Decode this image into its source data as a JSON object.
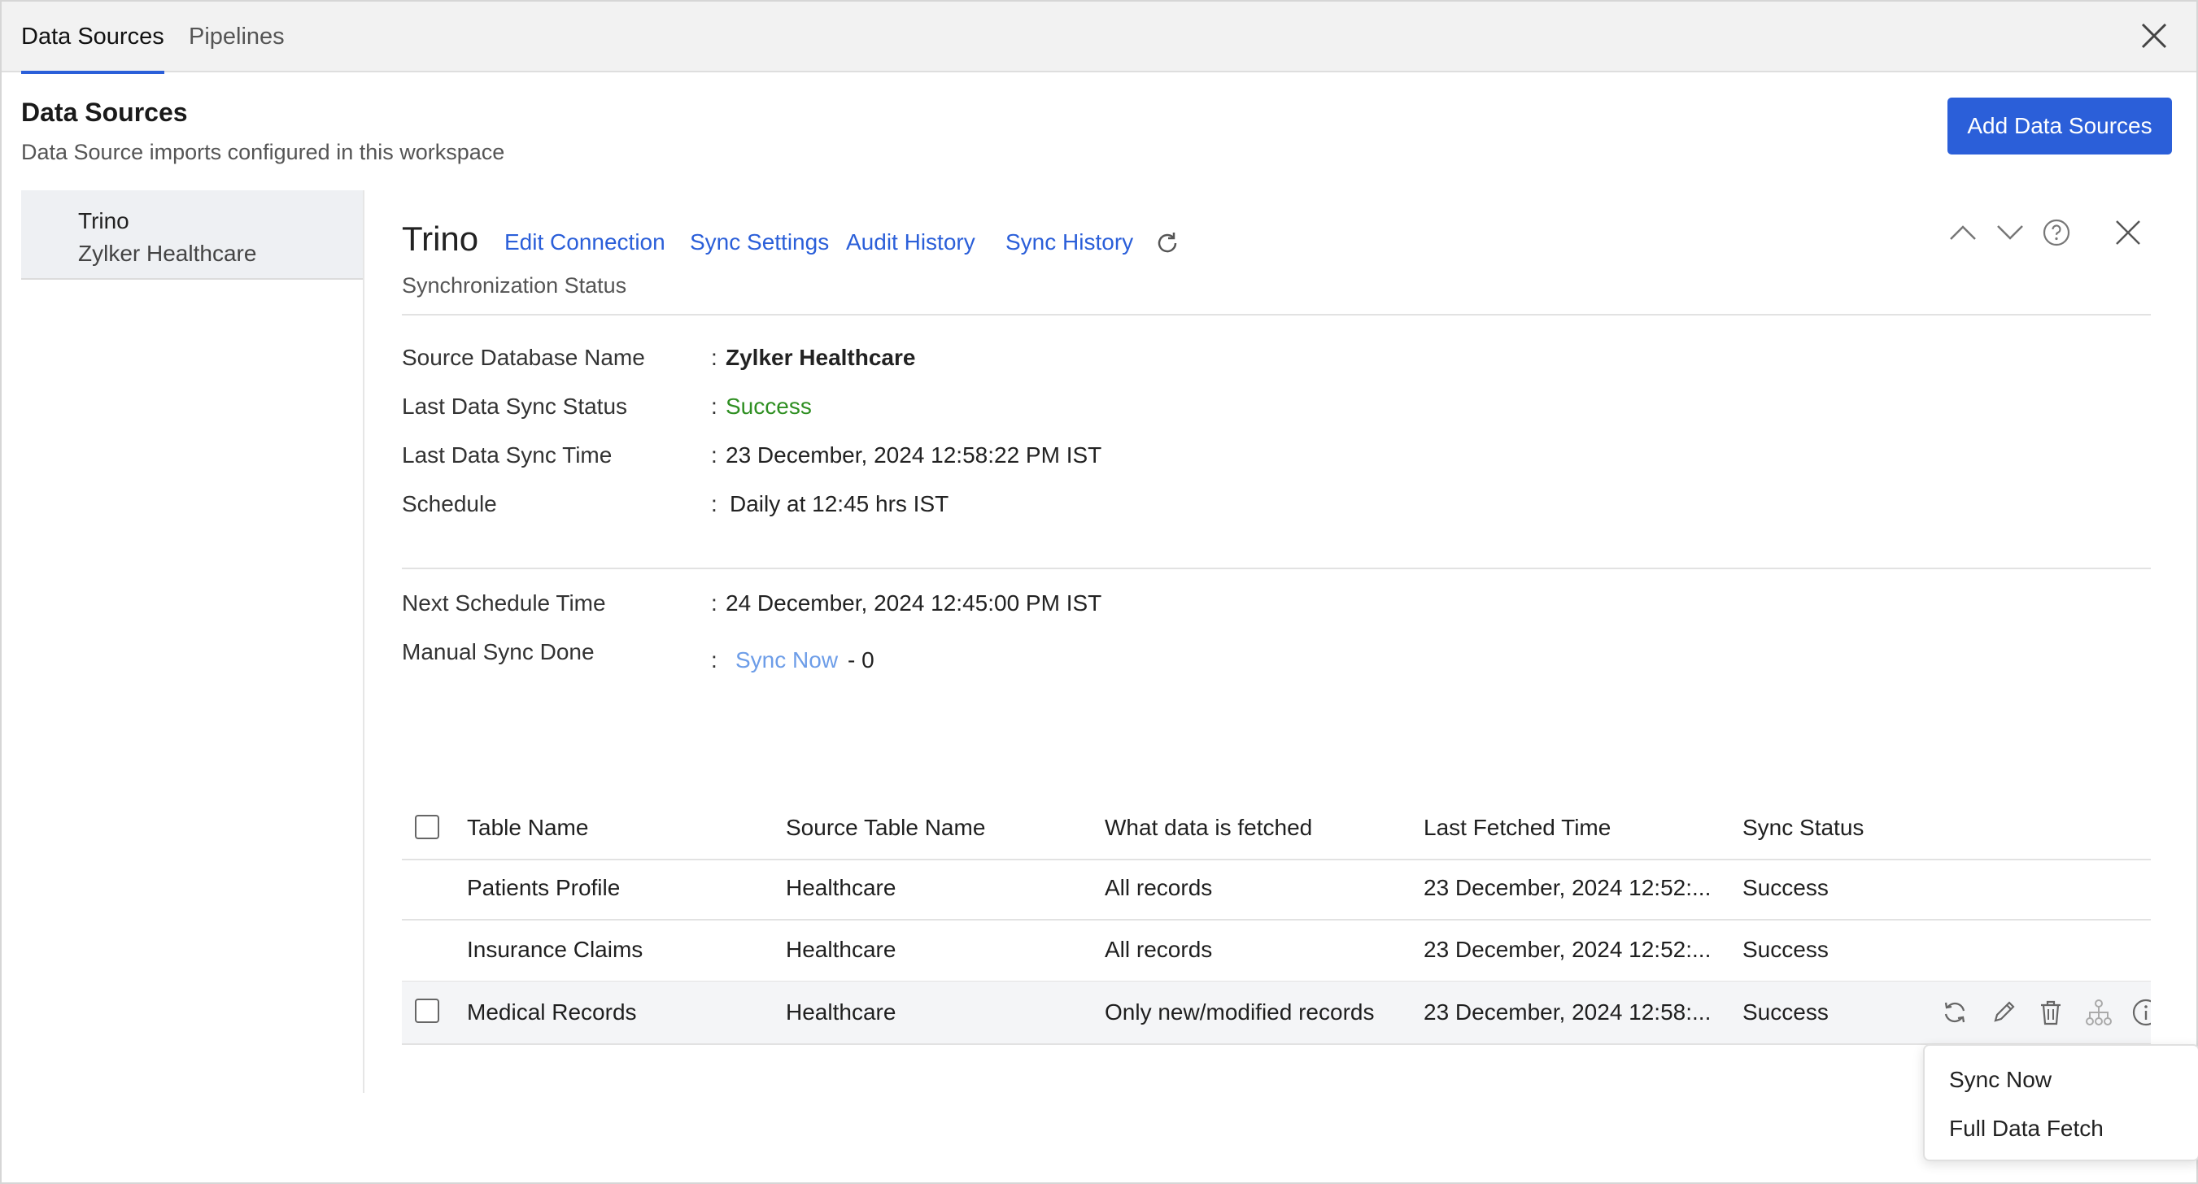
{
  "tabs": [
    {
      "label": "Data Sources",
      "active": true
    },
    {
      "label": "Pipelines",
      "active": false
    }
  ],
  "header": {
    "title": "Data Sources",
    "subtitle": "Data Source imports configured in this workspace",
    "add_button": "Add Data Sources"
  },
  "sources": [
    {
      "name": "Trino",
      "database": "Zylker Healthcare"
    }
  ],
  "detail": {
    "title": "Trino",
    "links": [
      "Edit Connection",
      "Sync Settings",
      "Audit History",
      "Sync History"
    ],
    "subtitle": "Synchronization Status",
    "info": [
      {
        "label": "Source Database Name",
        "value": "Zylker Healthcare"
      },
      {
        "label": "Last Data Sync Status",
        "value": "Success"
      },
      {
        "label": "Last Data Sync Time",
        "value": "23 December, 2024 12:58:22 PM IST"
      },
      {
        "label": "Schedule",
        "value": "Daily at 12:45 hrs IST"
      }
    ],
    "next_schedule": {
      "label": "Next Schedule Time",
      "value": "24 December, 2024 12:45:00 PM IST"
    },
    "manual_sync": {
      "label": "Manual Sync Done",
      "link": "Sync Now",
      "count": "- 0"
    },
    "colon": ":"
  },
  "table": {
    "columns": [
      "Table Name",
      "Source Table Name",
      "What data is fetched",
      "Last Fetched Time",
      "Sync Status"
    ],
    "rows": [
      [
        "Patients Profile",
        "Healthcare",
        "All records",
        "23 December, 2024 12:52:...",
        "Success"
      ],
      [
        "Insurance Claims",
        "Healthcare",
        "All records",
        "23 December, 2024 12:52:...",
        "Success"
      ],
      [
        "Medical Records",
        "Healthcare",
        "Only new/modified records",
        "23 December, 2024 12:58:...",
        "Success"
      ]
    ]
  },
  "menu": [
    "Sync Now",
    "Full Data Fetch"
  ],
  "colors": {
    "accent": "#2b5fd9",
    "success": "#2f8f22",
    "link_light": "#6d9de8"
  },
  "icons": [
    "close-icon",
    "refresh-icon",
    "chevron-up-icon",
    "chevron-down-icon",
    "help-icon",
    "sync-icon",
    "edit-icon",
    "delete-icon",
    "lineage-icon",
    "info-icon"
  ]
}
